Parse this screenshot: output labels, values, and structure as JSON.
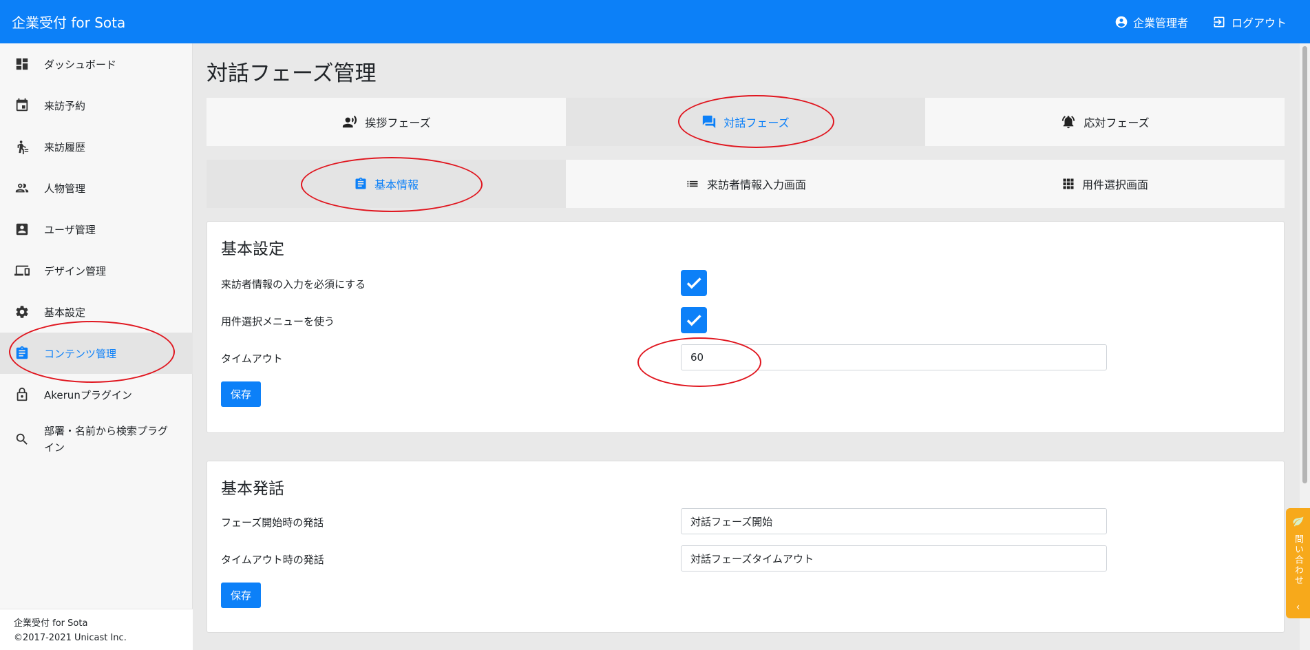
{
  "header": {
    "brand": "企業受付 for Sota",
    "user_label": "企業管理者",
    "logout_label": "ログアウト"
  },
  "sidebar": {
    "items": [
      {
        "label": "ダッシュボード",
        "icon": "dashboard-icon"
      },
      {
        "label": "来訪予約",
        "icon": "calendar-icon"
      },
      {
        "label": "来訪履歴",
        "icon": "walking-person-icon"
      },
      {
        "label": "人物管理",
        "icon": "people-icon"
      },
      {
        "label": "ユーザ管理",
        "icon": "account-box-icon"
      },
      {
        "label": "デザイン管理",
        "icon": "devices-icon"
      },
      {
        "label": "基本設定",
        "icon": "gear-icon"
      },
      {
        "label": "コンテンツ管理",
        "icon": "clipboard-icon"
      },
      {
        "label": "Akerunプラグイン",
        "icon": "lock-icon"
      },
      {
        "label": "部署・名前から検索プラグイン",
        "icon": "search-icon"
      }
    ],
    "active_index": 7,
    "footer_line1": "企業受付 for Sota",
    "footer_line2": "©2017-2021 Unicast Inc."
  },
  "main": {
    "page_title": "対話フェーズ管理",
    "phase_tabs": [
      {
        "label": "挨拶フェーズ",
        "icon": "speaking-person-icon"
      },
      {
        "label": "対話フェーズ",
        "icon": "chat-icon"
      },
      {
        "label": "応対フェーズ",
        "icon": "bell-icon"
      }
    ],
    "phase_active": 1,
    "sub_tabs": [
      {
        "label": "基本情報",
        "icon": "clipboard-icon"
      },
      {
        "label": "来訪者情報入力画面",
        "icon": "list-icon"
      },
      {
        "label": "用件選択画面",
        "icon": "grid-icon"
      }
    ],
    "sub_active": 0,
    "basic_settings": {
      "title": "基本設定",
      "require_visitor_info_label": "来訪者情報の入力を必須にする",
      "require_visitor_info_checked": true,
      "use_purpose_menu_label": "用件選択メニューを使う",
      "use_purpose_menu_checked": true,
      "timeout_label": "タイムアウト",
      "timeout_value": "60",
      "save_label": "保存"
    },
    "basic_speech": {
      "title": "基本発話",
      "start_label": "フェーズ開始時の発話",
      "start_value": "対話フェーズ開始",
      "timeout_label": "タイムアウト時の発話",
      "timeout_value": "対話フェーズタイムアウト",
      "save_label": "保存"
    }
  },
  "contact_tab": {
    "label": "問い合わせ",
    "chevron": "‹"
  },
  "colors": {
    "primary": "#0c80f8",
    "annotation": "#e0161f",
    "contact": "#f7a91b"
  }
}
